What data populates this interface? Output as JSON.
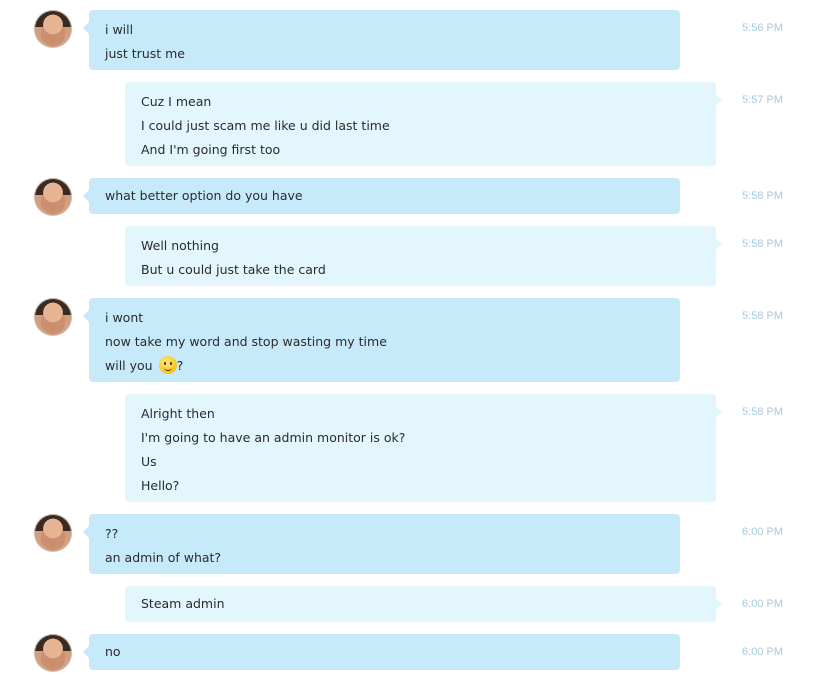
{
  "messages": [
    {
      "sender": "them",
      "time": "5:56 PM",
      "lines": [
        "i will",
        "just trust me"
      ]
    },
    {
      "sender": "me",
      "time": "5:57 PM",
      "lines": [
        "Cuz I mean",
        "I could just scam me like u did last time",
        "And I'm going first too"
      ]
    },
    {
      "sender": "them",
      "time": "5:58 PM",
      "lines": [
        "what better option do you have"
      ]
    },
    {
      "sender": "me",
      "time": "5:58 PM",
      "lines": [
        "Well nothing",
        "But u could just take the card"
      ]
    },
    {
      "sender": "them",
      "time": "5:58 PM",
      "lines": [
        "i wont",
        "now take my word and stop wasting my time"
      ],
      "emoji_line": {
        "before": "will you",
        "after": "?",
        "icon": "smiley-icon"
      }
    },
    {
      "sender": "me",
      "time": "5:58 PM",
      "lines": [
        "Alright then",
        "I'm going to have an admin monitor is ok?",
        "Us",
        "Hello?"
      ]
    },
    {
      "sender": "them",
      "time": "6:00 PM",
      "lines": [
        "??",
        "an admin of what?"
      ]
    },
    {
      "sender": "me",
      "time": "6:00 PM",
      "lines": [
        "Steam admin"
      ]
    },
    {
      "sender": "them",
      "time": "6:00 PM",
      "lines": [
        "no"
      ]
    }
  ],
  "avatar_icon": "user-avatar-icon",
  "colors": {
    "them_bubble": "#c7eafb",
    "me_bubble": "#e3f5fd",
    "timestamp": "#a7c9dc"
  }
}
